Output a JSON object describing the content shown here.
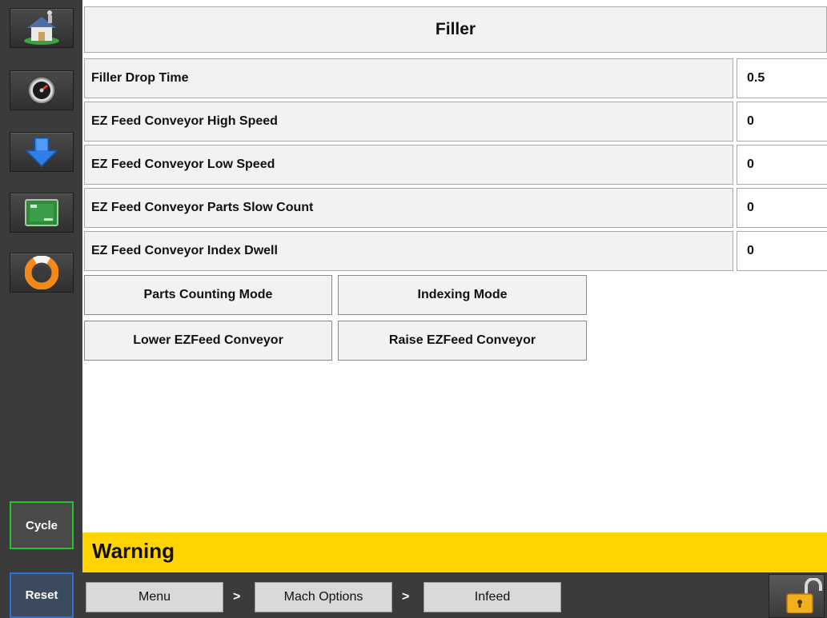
{
  "header": {
    "title": "Filler"
  },
  "sidebar": {
    "items": [
      {
        "icon": "home-icon"
      },
      {
        "icon": "gauge-icon"
      },
      {
        "icon": "download-arrow-icon"
      },
      {
        "icon": "cpu-chip-icon"
      },
      {
        "icon": "lifebuoy-icon"
      }
    ],
    "cycle_label": "Cycle",
    "reset_label": "Reset"
  },
  "params": [
    {
      "label": "Filler Drop Time",
      "value": "0.5"
    },
    {
      "label": "EZ Feed Conveyor High Speed",
      "value": "0"
    },
    {
      "label": "EZ Feed Conveyor Low Speed",
      "value": "0"
    },
    {
      "label": "EZ Feed Conveyor Parts Slow Count",
      "value": "0"
    },
    {
      "label": "EZ Feed Conveyor Index Dwell",
      "value": "0"
    }
  ],
  "actions": {
    "parts_counting_mode": "Parts Counting Mode",
    "indexing_mode": "Indexing Mode",
    "lower_conveyor": "Lower EZFeed Conveyor",
    "raise_conveyor": "Raise EZFeed Conveyor"
  },
  "warning": {
    "text": "Warning",
    "color": "#ffd400"
  },
  "breadcrumb": {
    "items": [
      "Menu",
      "Mach Options",
      "Infeed"
    ],
    "separator": ">"
  },
  "colors": {
    "cycle_border": "#27c327",
    "reset_border": "#2d72d9",
    "sidebar_bg": "#3b3b3b"
  },
  "lock": {
    "icon": "unlocked-padlock-icon"
  }
}
